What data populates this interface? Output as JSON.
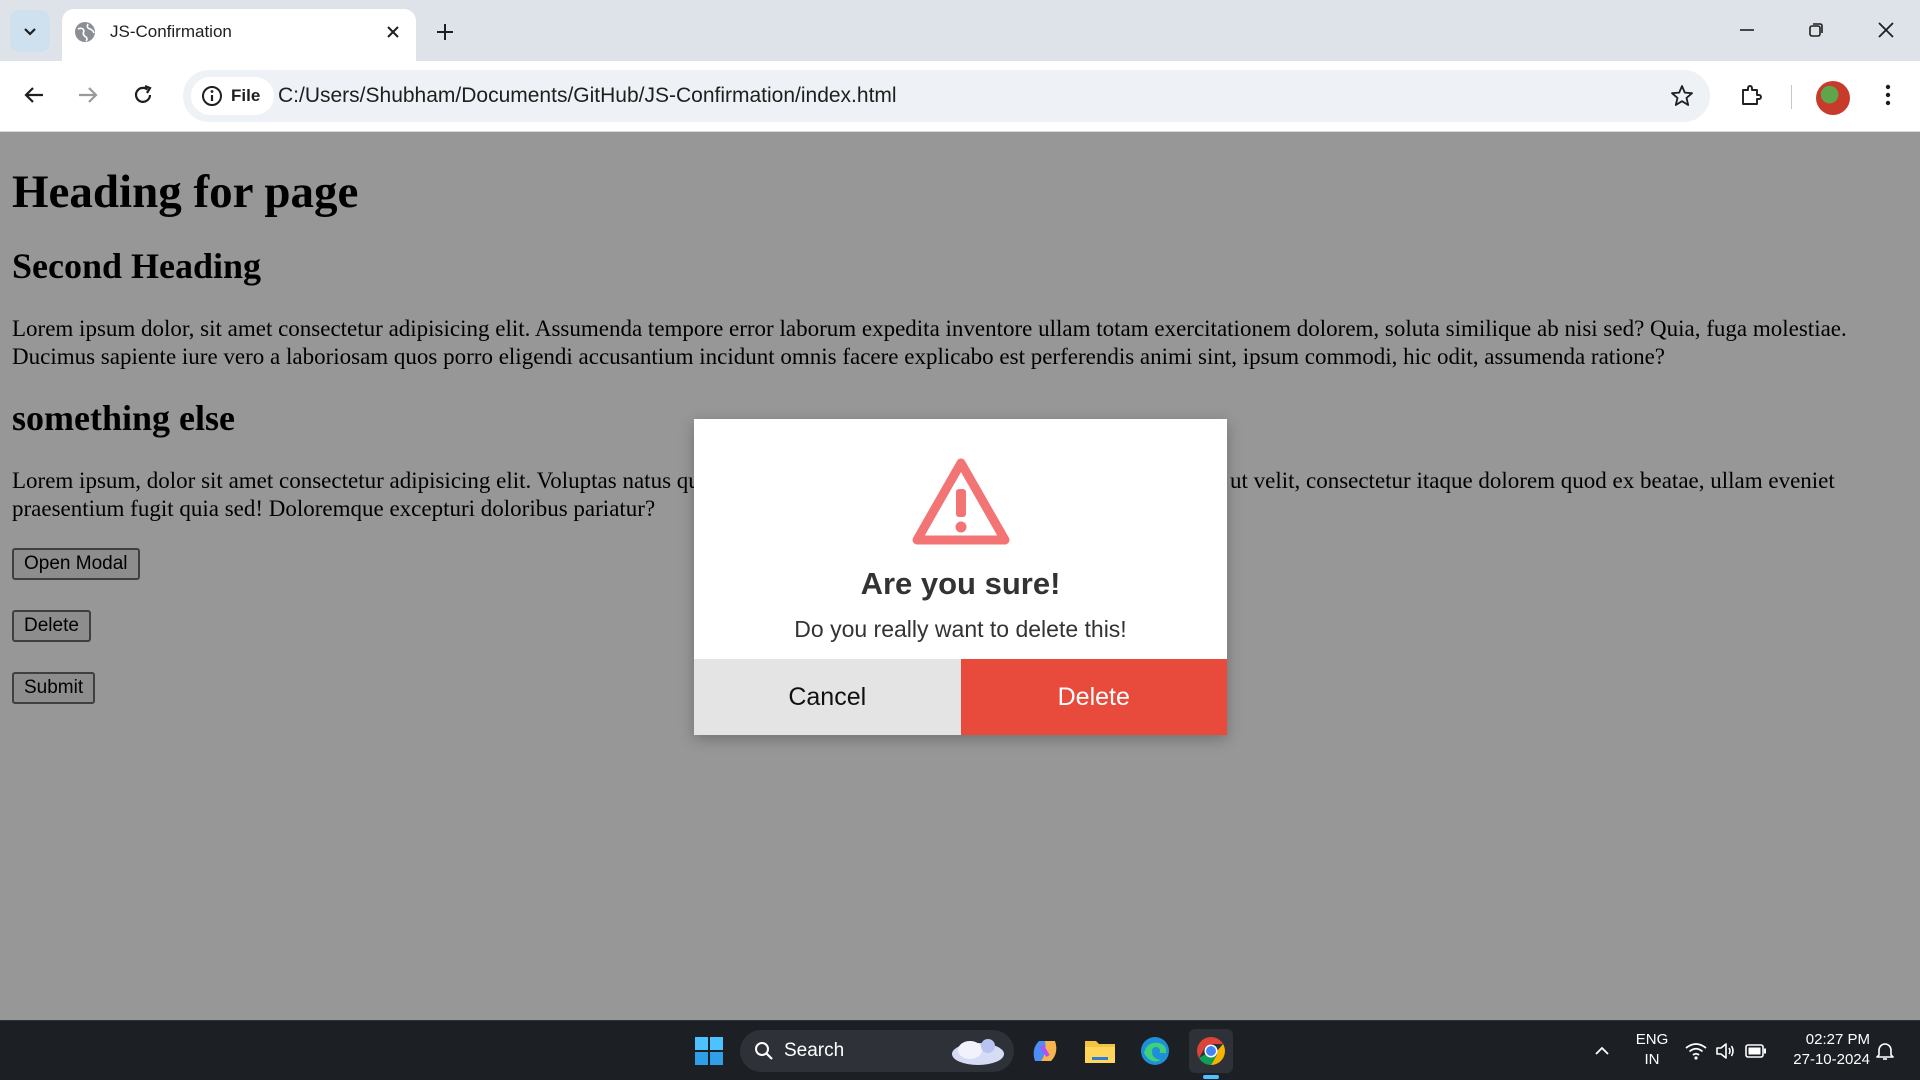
{
  "browser": {
    "tab_title": "JS-Confirmation",
    "address_chip_label": "File",
    "url": "C:/Users/Shubham/Documents/GitHub/JS-Confirmation/index.html"
  },
  "page": {
    "heading1": "Heading for page",
    "heading2": "Second Heading",
    "paragraph1": "Lorem ipsum dolor, sit amet consectetur adipisicing elit. Assumenda tempore error laborum expedita inventore ullam totam exercitationem dolorem, soluta similique ab nisi sed? Quia, fuga molestiae. Ducimus sapiente iure vero a laboriosam quos porro eligendi accusantium incidunt omnis facere explicabo est perferendis animi sint, ipsum commodi, hic odit, assumenda ratione?",
    "heading3": "something else",
    "paragraph2": "Lorem ipsum, dolor sit amet consectetur adipisicing elit. Voluptas natus quia sunt voluptatibus laboriosam quasi, cumque numquam ut velit, consectetur itaque dolorem quod ex beatae, ullam eveniet praesentium fugit quia sed! Doloremque excepturi doloribus pariatur?",
    "buttons": {
      "open_modal": "Open Modal",
      "delete": "Delete",
      "submit": "Submit"
    }
  },
  "modal": {
    "title": "Are you sure!",
    "message": "Do you really want to delete this!",
    "cancel_label": "Cancel",
    "delete_label": "Delete",
    "icon_color": "#f27474",
    "delete_color": "#e84b3c"
  },
  "taskbar": {
    "search_label": "Search",
    "language_top": "ENG",
    "language_bottom": "IN",
    "time": "02:27 PM",
    "date": "27-10-2024"
  }
}
